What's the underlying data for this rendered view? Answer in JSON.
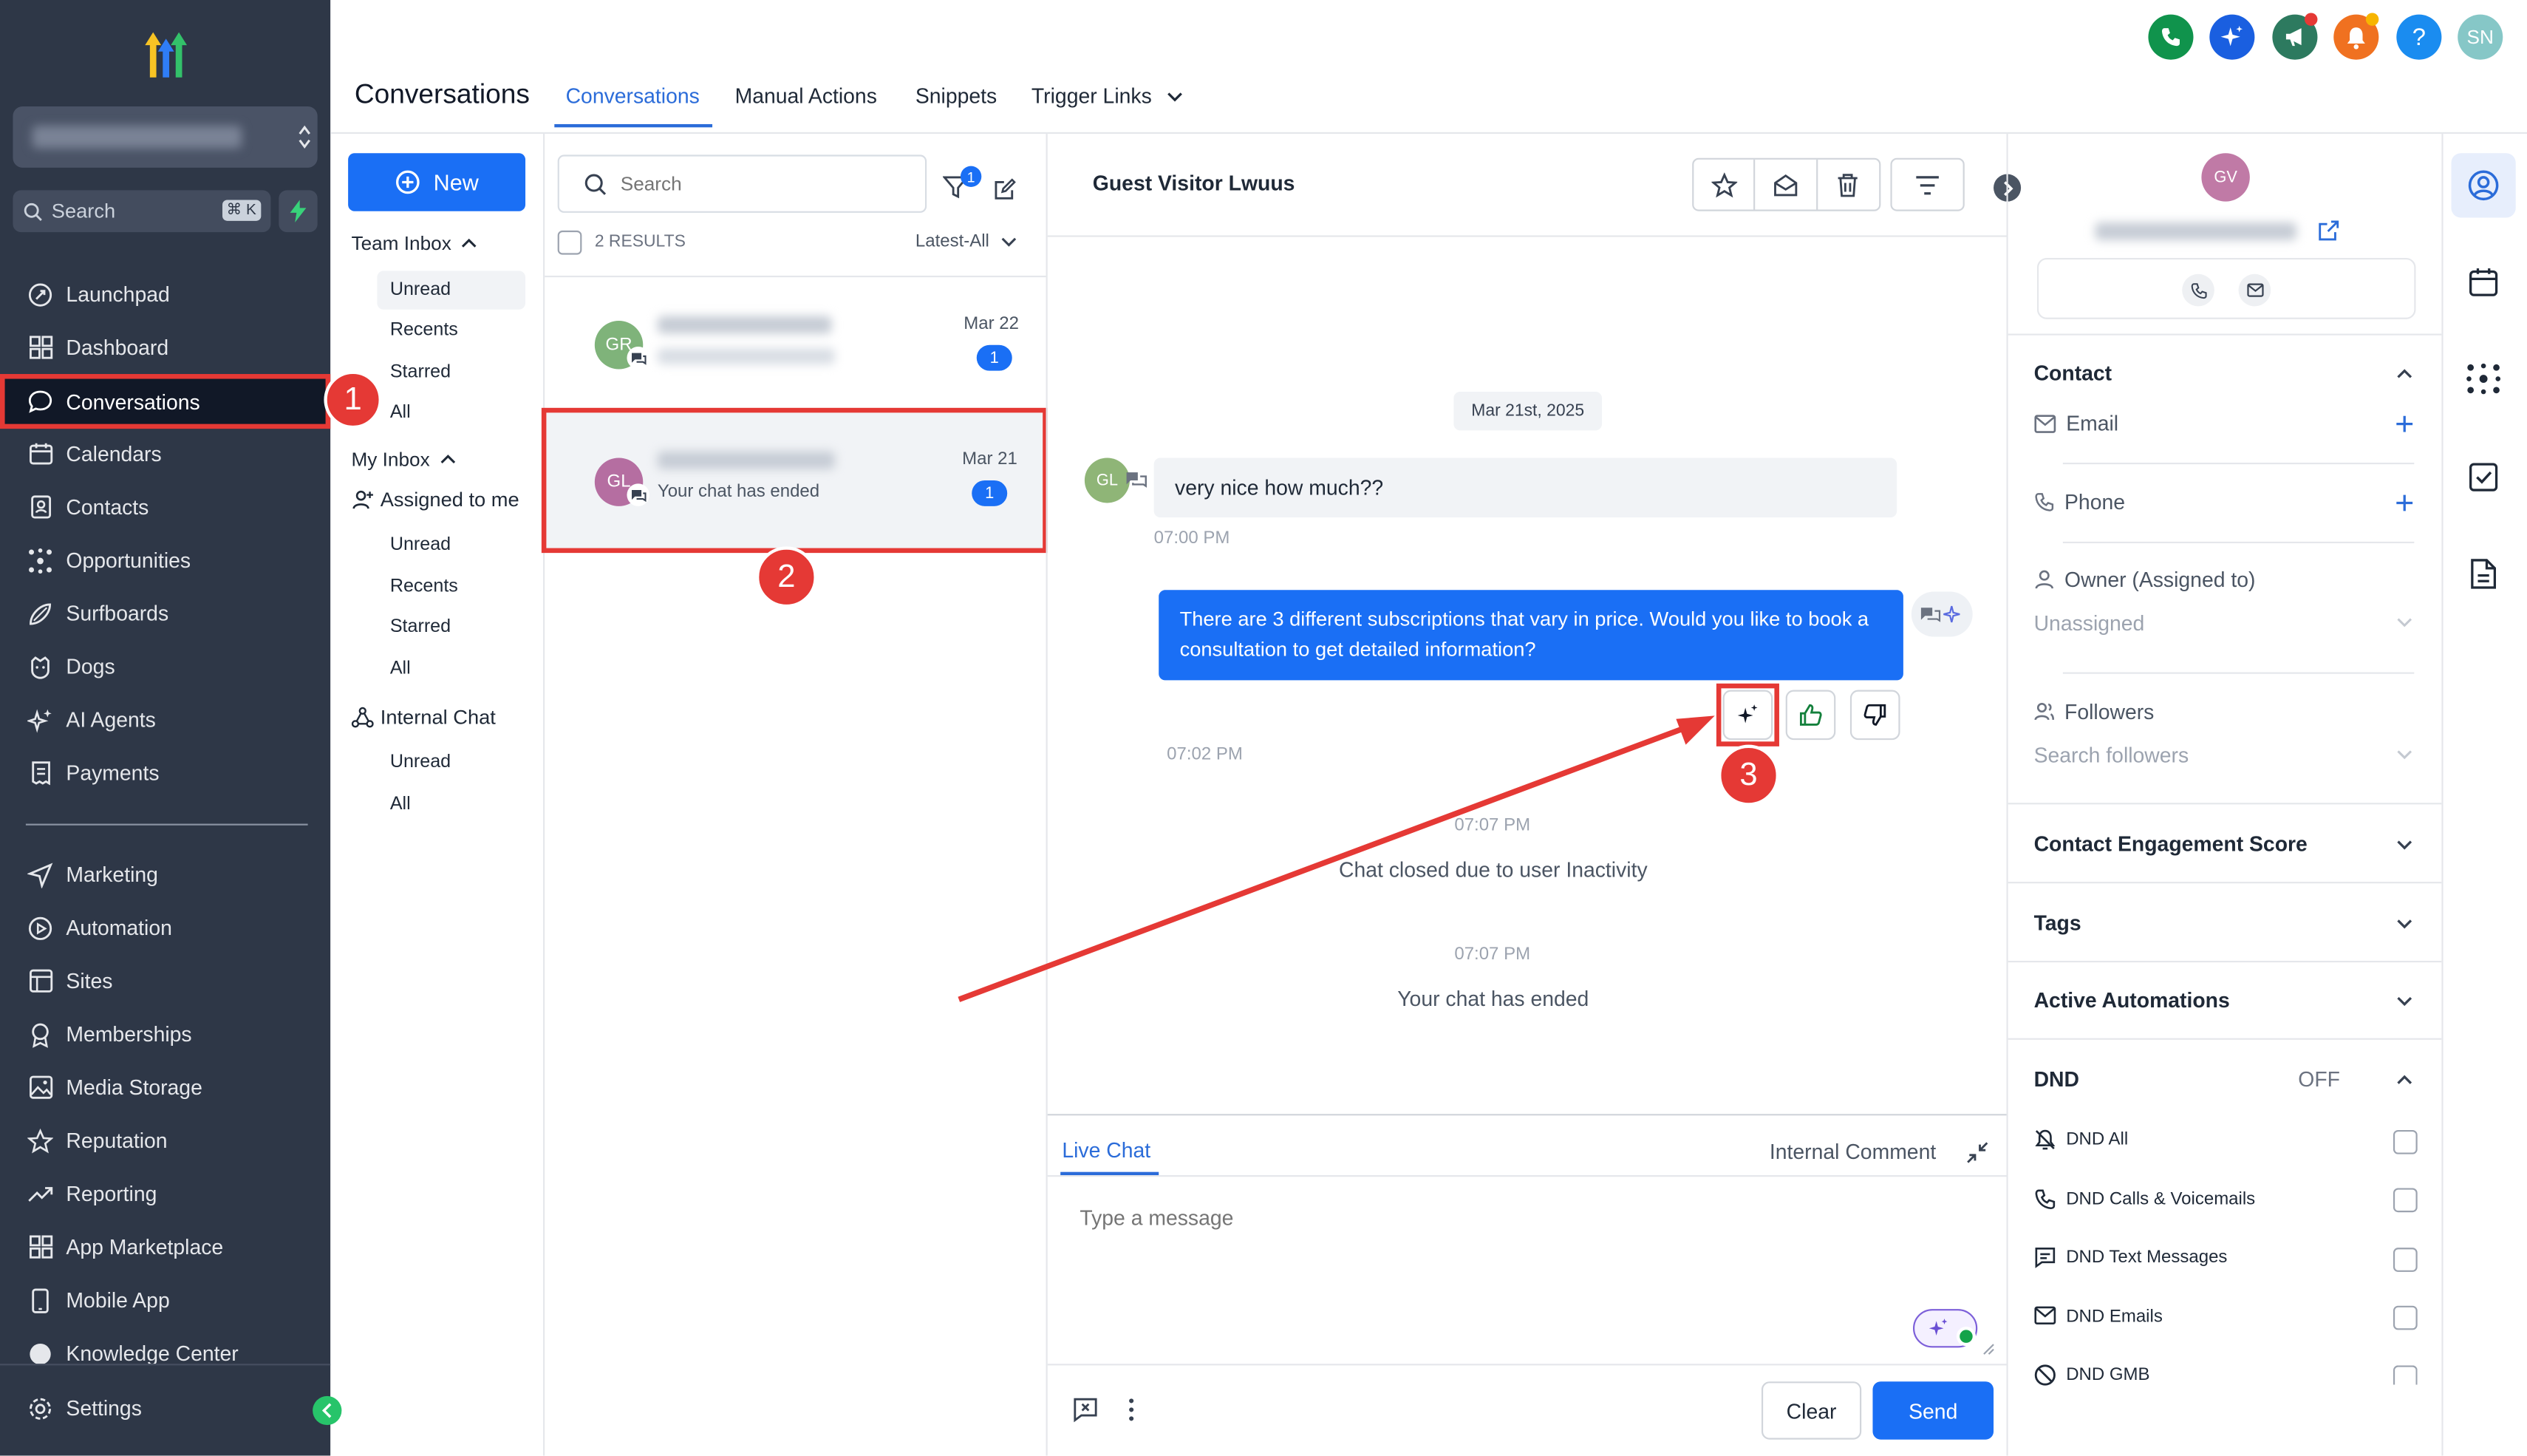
{
  "sidebar": {
    "search_placeholder": "Search",
    "search_shortcut": "⌘ K",
    "items": [
      {
        "label": "Launchpad"
      },
      {
        "label": "Dashboard"
      },
      {
        "label": "Conversations"
      },
      {
        "label": "Calendars"
      },
      {
        "label": "Contacts"
      },
      {
        "label": "Opportunities"
      },
      {
        "label": "Surfboards"
      },
      {
        "label": "Dogs"
      },
      {
        "label": "AI Agents"
      },
      {
        "label": "Payments"
      },
      {
        "label": "Marketing"
      },
      {
        "label": "Automation"
      },
      {
        "label": "Sites"
      },
      {
        "label": "Memberships"
      },
      {
        "label": "Media Storage"
      },
      {
        "label": "Reputation"
      },
      {
        "label": "Reporting"
      },
      {
        "label": "App Marketplace"
      },
      {
        "label": "Mobile App"
      },
      {
        "label": "Knowledge Center"
      }
    ],
    "settings_label": "Settings"
  },
  "header": {
    "title": "Conversations",
    "tabs": [
      "Conversations",
      "Manual Actions",
      "Snippets",
      "Trigger Links"
    ],
    "avatar_initials": "SN",
    "help_label": "?"
  },
  "inbox_nav": {
    "new_label": "New",
    "team_inbox": "Team Inbox",
    "team_items": [
      "Unread",
      "Recents",
      "Starred",
      "All"
    ],
    "my_inbox": "My Inbox",
    "assigned": "Assigned to me",
    "my_items": [
      "Unread",
      "Recents",
      "Starred",
      "All"
    ],
    "internal_chat": "Internal Chat",
    "internal_items": [
      "Unread",
      "All"
    ]
  },
  "list": {
    "search_placeholder": "Search",
    "filter_badge": "1",
    "results": "2 RESULTS",
    "sort": "Latest-All",
    "items": [
      {
        "initials": "GR",
        "date": "Mar 22",
        "preview": "",
        "badge": "1"
      },
      {
        "initials": "GL",
        "date": "Mar 21",
        "preview": "Your chat has ended",
        "badge": "1"
      }
    ]
  },
  "chat": {
    "title": "Guest Visitor Lwuus",
    "date_chip": "Mar 21st, 2025",
    "msg_in_initials": "GL",
    "msg_in": "very nice how much??",
    "msg_in_time": "07:00 PM",
    "msg_out": "There are 3 different subscriptions that vary in price. Would you like to book a consultation to get detailed information?",
    "msg_out_time": "07:02 PM",
    "sys1_time": "07:07 PM",
    "sys1": "Chat closed due to user Inactivity",
    "sys2_time": "07:07 PM",
    "sys2": "Your chat has ended",
    "composer_tab_live": "Live Chat",
    "composer_tab_internal": "Internal Comment",
    "composer_placeholder": "Type a message",
    "clear_label": "Clear",
    "send_label": "Send"
  },
  "contact_panel": {
    "initials": "GV",
    "contact_header": "Contact",
    "email_label": "Email",
    "phone_label": "Phone",
    "owner_label": "Owner (Assigned to)",
    "owner_value": "Unassigned",
    "followers_label": "Followers",
    "followers_placeholder": "Search followers",
    "engagement": "Contact Engagement Score",
    "tags": "Tags",
    "automations": "Active Automations",
    "dnd": "DND",
    "dnd_state": "OFF",
    "dnd_items": [
      "DND All",
      "DND Calls & Voicemails",
      "DND Text Messages",
      "DND Emails",
      "DND GMB"
    ]
  },
  "annotations": {
    "step1": "1",
    "step2": "2",
    "step3": "3"
  },
  "colors": {
    "sidebar_bg": "#2e3747",
    "primary": "#1a6ff5",
    "highlight_red": "#e53935"
  }
}
